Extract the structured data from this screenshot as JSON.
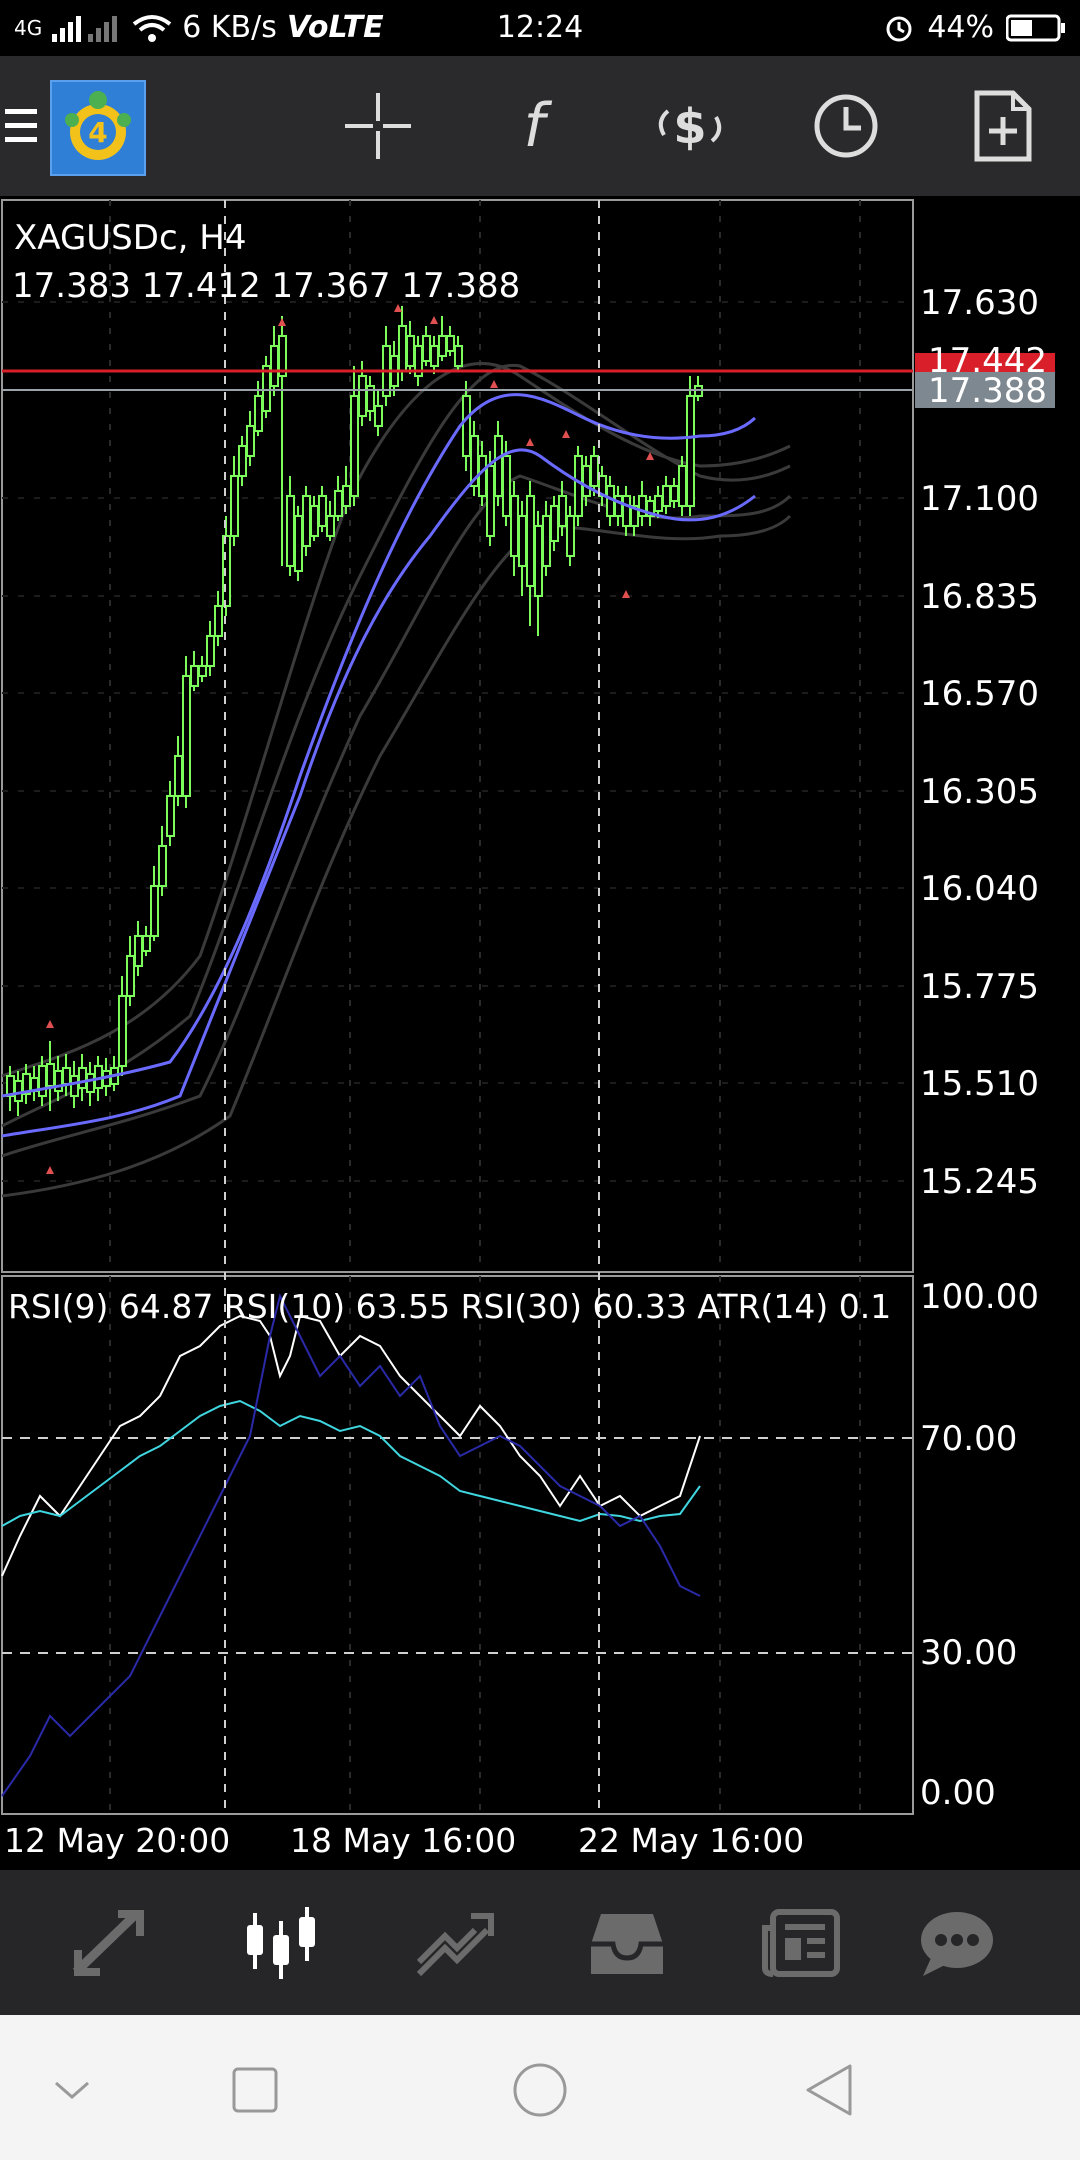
{
  "status_bar": {
    "network": "4G",
    "speed": "6 KB/s",
    "volte": "VoLTE",
    "time": "12:24",
    "battery": "44%"
  },
  "toolbar": {
    "icons": [
      "menu-icon",
      "metatrader-logo",
      "crosshair-icon",
      "indicators-icon",
      "trade-icon",
      "timeframe-icon",
      "new-order-icon"
    ]
  },
  "chart": {
    "symbol": "XAGUSDc, H4",
    "ohlc": "17.383 17.412 17.367 17.388",
    "price_labels": [
      "17.630",
      "17.100",
      "16.835",
      "16.570",
      "16.305",
      "16.040",
      "15.775",
      "15.510",
      "15.245"
    ],
    "ask_label": "17.442",
    "bid_label": "17.388",
    "indicator_text": "RSI(9) 64.87 RSI(10) 63.55 RSI(30) 60.33 ATR(14) 0.1",
    "rsi_labels": [
      "100.00",
      "70.00",
      "30.00",
      "0.00"
    ],
    "time_labels": [
      "12 May 20:00",
      "18 May 16:00",
      "22 May 16:00"
    ],
    "colors": {
      "bull": "#7cfc5a",
      "bear": "#7cfc5a",
      "ma": "#6a6aff",
      "bands": "#3a3a3a",
      "ask": "#d9202a",
      "bid": "#7d8890",
      "rsi_fast": "#ffffff",
      "rsi_mid": "#3fd6e0",
      "rsi_slow": "#2a2aa8"
    }
  },
  "bottom_nav": {
    "items": [
      "quotes-icon",
      "chart-icon",
      "trade-icon",
      "history-icon",
      "news-icon",
      "chat-icon"
    ],
    "active": "chart-icon"
  },
  "system_nav": {
    "items": [
      "collapse-icon",
      "recents-icon",
      "home-icon",
      "back-icon"
    ]
  }
}
